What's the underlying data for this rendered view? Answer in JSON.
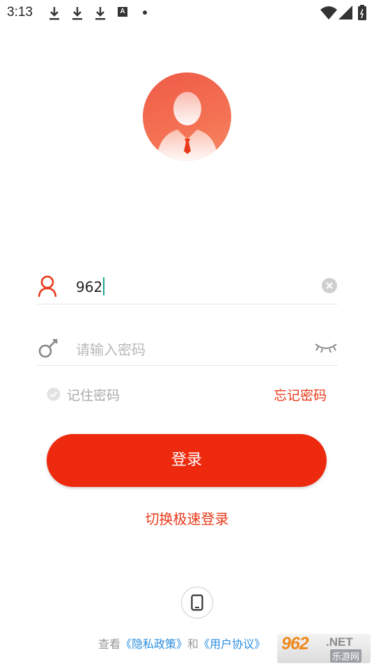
{
  "status_bar": {
    "time": "3:13",
    "notification_icons": [
      "download-icon",
      "download-icon",
      "download-icon",
      "a-letter-icon",
      "dot-icon"
    ],
    "a_icon_label": "A"
  },
  "avatar": {
    "icon": "person-avatar-icon",
    "gradient": [
      "#ef5a47",
      "#f78a64"
    ]
  },
  "username": {
    "icon": "user-icon",
    "value": "962",
    "clear_icon": "clear-icon"
  },
  "password": {
    "icon": "key-icon",
    "placeholder": "请输入密码",
    "toggle_icon": "eye-closed-icon"
  },
  "remember": {
    "label": "记住密码",
    "checked": false
  },
  "forgot": {
    "label": "忘记密码"
  },
  "login_button": {
    "label": "登录",
    "color": "#ee2a0e"
  },
  "switch_login": {
    "label": "切换极速登录"
  },
  "phone_login": {
    "icon": "phone-icon"
  },
  "agreement": {
    "prefix": "查看",
    "privacy": "《隐私政策》",
    "and": "和",
    "terms": "《用户协议》"
  },
  "watermark": {
    "main": "962",
    "suffix": ".NET",
    "cn": "乐游网"
  },
  "colors": {
    "accent": "#e8391a",
    "link": "#2a8de0"
  }
}
